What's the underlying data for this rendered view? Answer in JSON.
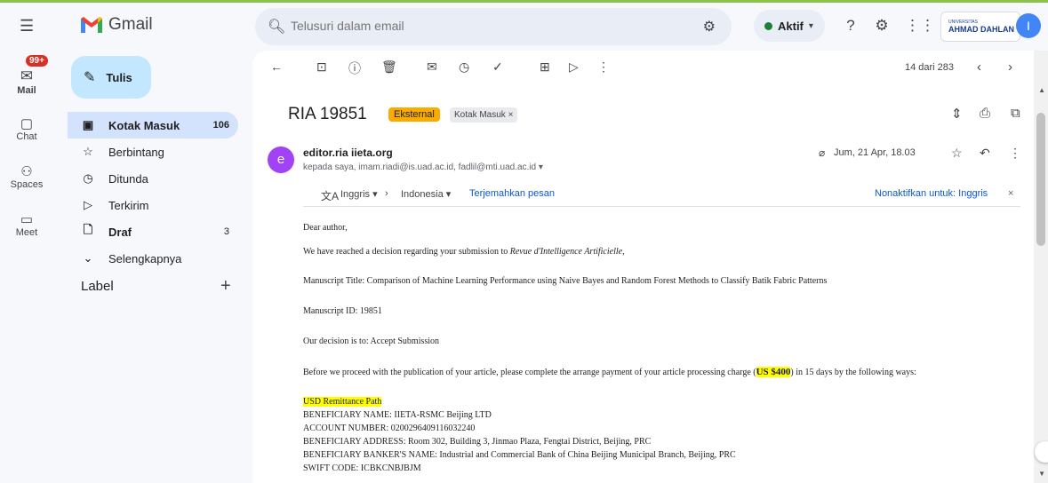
{
  "header": {
    "app_name": "Gmail",
    "search_placeholder": "Telusuri dalam email",
    "status_label": "Aktif",
    "org_small": "UNIVERSITAS",
    "org_name": "AHMAD DAHLAN",
    "avatar_letter": "I"
  },
  "rail": {
    "mail_badge": "99+",
    "items": [
      {
        "label": "Mail"
      },
      {
        "label": "Chat"
      },
      {
        "label": "Spaces"
      },
      {
        "label": "Meet"
      }
    ]
  },
  "sidebar": {
    "compose_label": "Tulis",
    "items": [
      {
        "label": "Kotak Masuk",
        "count": "106"
      },
      {
        "label": "Berbintang",
        "count": ""
      },
      {
        "label": "Ditunda",
        "count": ""
      },
      {
        "label": "Terkirim",
        "count": ""
      },
      {
        "label": "Draf",
        "count": "3"
      },
      {
        "label": "Selengkapnya",
        "count": ""
      }
    ],
    "label_header": "Label"
  },
  "toolbar": {
    "pager_text": "14 dari 283"
  },
  "email": {
    "subject": "RIA 19851",
    "chip_external": "Eksternal",
    "chip_inbox": "Kotak Masuk ×",
    "sender_letter": "e",
    "sender": "editor.ria iieta.org",
    "recipients": "kepada saya, imam.riadi@is.uad.ac.id, fadlil@mti.uad.ac.id ▾",
    "date": "Jum, 21 Apr, 18.03",
    "translate": {
      "from": "Inggris ▾",
      "to": "Indonesia ▾",
      "link": "Terjemahkan pesan",
      "disable": "Nonaktifkan untuk: Inggris"
    },
    "body": {
      "greeting": "Dear author,",
      "line1_pre": "We have reached a decision regarding your submission to ",
      "line1_journal": "Revue d'Intelligence Artificielle",
      "line1_post": ",",
      "title_line": "Manuscript Title: Comparison of Machine Learning Performance using Naive Bayes and Random Forest Methods to Classify Batik Fabric Patterns",
      "id_line": "Manuscript ID: 19851",
      "decision_line": "Our decision is to: Accept Submission",
      "payment_pre": "Before we proceed with the publication of your article, please complete the arrange payment of your article processing charge (",
      "payment_amount": "US  $400",
      "payment_post": ") in 15 days by the following ways:",
      "remit_header": "USD Remittance Path",
      "beneficiary_name": "BENEFICIARY NAME: IIETA-RSMC Beijing LTD",
      "account_number": "ACCOUNT NUMBER: 0200296409116032240",
      "beneficiary_address": "BENEFICIARY ADDRESS: Room 302, Building 3, Jinmao Plaza, Fengtai District, Beijing, PRC",
      "banker_name": "BENEFICIARY BANKER'S NAME: Industrial and Commercial Bank of China Beijing Municipal Branch, Beijing, PRC",
      "swift": "SWIFT CODE: ICBKCNBJBJM"
    }
  },
  "colors": {
    "accent": "#c2e7ff",
    "active_nav": "#d3e3fd",
    "external_chip": "#f9ab00",
    "highlight": "#ffff00"
  }
}
